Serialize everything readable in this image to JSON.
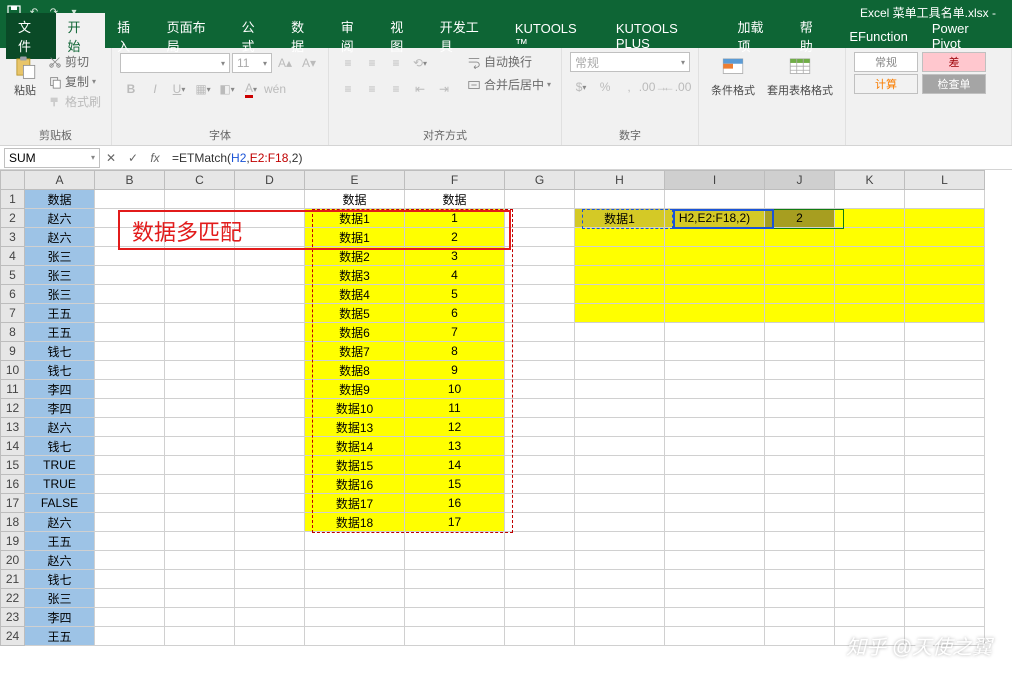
{
  "app": {
    "title": "Excel 菜单工具名单.xlsx -"
  },
  "qat": {
    "save": "save-icon",
    "undo": "undo-icon",
    "redo": "redo-icon",
    "dd": "▾"
  },
  "tabs": {
    "file": "文件",
    "home": "开始",
    "insert": "插入",
    "layout": "页面布局",
    "formula": "公式",
    "data": "数据",
    "review": "审阅",
    "view": "视图",
    "dev": "开发工具",
    "kutools": "KUTOOLS ™",
    "kutoolsplus": "KUTOOLS PLUS",
    "addins": "加载项",
    "help": "帮助",
    "efunction": "EFunction",
    "powerpivot": "Power Pivot"
  },
  "ribbon": {
    "clipboard": {
      "label": "剪贴板",
      "paste": "粘贴",
      "cut": "剪切",
      "copy": "复制",
      "painter": "格式刷"
    },
    "font": {
      "label": "字体",
      "size": "11"
    },
    "alignment": {
      "label": "对齐方式",
      "wrap": "自动换行",
      "merge": "合并后居中"
    },
    "number": {
      "label": "数字",
      "format": "常规"
    },
    "styles": {
      "cond": "条件格式",
      "table": "套用表格格式"
    },
    "cells": {
      "normal": "常规",
      "bad": "差",
      "calc": "计算",
      "check": "检查单"
    }
  },
  "namebox": "SUM",
  "formula": {
    "fn": "ETMatch",
    "arg1": "H2",
    "arg2": "E2:F18",
    "arg3": "2"
  },
  "columns": [
    "A",
    "B",
    "C",
    "D",
    "E",
    "F",
    "G",
    "H",
    "I",
    "J",
    "K",
    "L"
  ],
  "rows": [
    {
      "n": 1,
      "A": "数据",
      "E": "数据",
      "F": "数据"
    },
    {
      "n": 2,
      "A": "赵六",
      "E": "数据1",
      "F": "1",
      "H": "数据1",
      "I": "H2,E2:F18,2)",
      "J": "2"
    },
    {
      "n": 3,
      "A": "赵六",
      "E": "数据1",
      "F": "2"
    },
    {
      "n": 4,
      "A": "张三",
      "E": "数据2",
      "F": "3"
    },
    {
      "n": 5,
      "A": "张三",
      "E": "数据3",
      "F": "4"
    },
    {
      "n": 6,
      "A": "张三",
      "E": "数据4",
      "F": "5"
    },
    {
      "n": 7,
      "A": "王五",
      "E": "数据5",
      "F": "6"
    },
    {
      "n": 8,
      "A": "王五",
      "E": "数据6",
      "F": "7"
    },
    {
      "n": 9,
      "A": "钱七",
      "E": "数据7",
      "F": "8"
    },
    {
      "n": 10,
      "A": "钱七",
      "E": "数据8",
      "F": "9"
    },
    {
      "n": 11,
      "A": "李四",
      "E": "数据9",
      "F": "10"
    },
    {
      "n": 12,
      "A": "李四",
      "E": "数据10",
      "F": "11"
    },
    {
      "n": 13,
      "A": "赵六",
      "E": "数据13",
      "F": "12"
    },
    {
      "n": 14,
      "A": "钱七",
      "E": "数据14",
      "F": "13"
    },
    {
      "n": 15,
      "A": "TRUE",
      "E": "数据15",
      "F": "14"
    },
    {
      "n": 16,
      "A": "TRUE",
      "E": "数据16",
      "F": "15"
    },
    {
      "n": 17,
      "A": "FALSE",
      "E": "数据17",
      "F": "16"
    },
    {
      "n": 18,
      "A": "赵六",
      "E": "数据18",
      "F": "17"
    },
    {
      "n": 19,
      "A": "王五"
    },
    {
      "n": 20,
      "A": "赵六"
    },
    {
      "n": 21,
      "A": "钱七"
    },
    {
      "n": 22,
      "A": "张三"
    },
    {
      "n": 23,
      "A": "李四"
    },
    {
      "n": 24,
      "A": "王五"
    }
  ],
  "annotation": "数据多匹配",
  "watermark": "知乎 @天使之翼"
}
